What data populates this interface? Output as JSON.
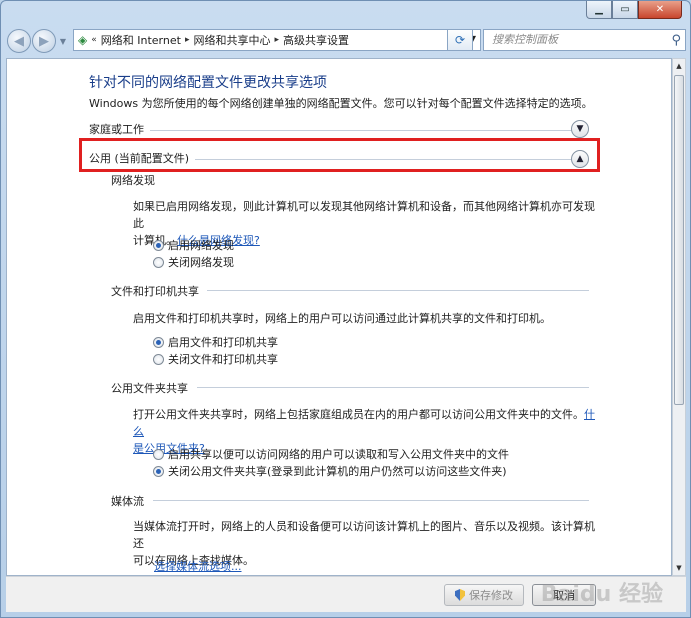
{
  "window": {
    "minimize": "▁",
    "maximize": "▭",
    "close": "✕"
  },
  "nav": {
    "back_icon": "back-arrow-icon",
    "forward_icon": "forward-arrow-icon",
    "breadcrumb": [
      "网络和 Internet",
      "网络和共享中心",
      "高级共享设置"
    ],
    "search_placeholder": "搜索控制面板"
  },
  "page": {
    "heading": "针对不同的网络配置文件更改共享选项",
    "intro": "Windows 为您所使用的每个网络创建单独的网络配置文件。您可以针对每个配置文件选择特定的选项。",
    "profile_home": "家庭或工作",
    "profile_public": "公用 (当前配置文件)"
  },
  "sections": {
    "discovery": {
      "title": "网络发现",
      "desc_line1": "如果已启用网络发现，则此计算机可以发现其他网络计算机和设备，而其他网络计算机亦可发现此",
      "desc_line2": "计算机。",
      "link": "什么是网络发现?",
      "option_on": "启用网络发现",
      "option_off": "关闭网络发现"
    },
    "printer": {
      "title": "文件和打印机共享",
      "desc": "启用文件和打印机共享时，网络上的用户可以访问通过此计算机共享的文件和打印机。",
      "option_on": "启用文件和打印机共享",
      "option_off": "关闭文件和打印机共享"
    },
    "public_folder": {
      "title": "公用文件夹共享",
      "desc_line1": "打开公用文件夹共享时，网络上包括家庭组成员在内的用户都可以访问公用文件夹中的文件。",
      "link1": "什么",
      "link2": "是公用文件夹?",
      "option_on": "启用共享以便可以访问网络的用户可以读取和写入公用文件夹中的文件",
      "option_off": "关闭公用文件夹共享(登录到此计算机的用户仍然可以访问这些文件夹)"
    },
    "media": {
      "title": "媒体流",
      "desc_line1": "当媒体流打开时，网络上的人员和设备便可以访问该计算机上的图片、音乐以及视频。该计算机还",
      "desc_line2": "可以在网络上查找媒体。",
      "link": "选择媒体流选项..."
    }
  },
  "footer": {
    "save": "保存修改",
    "cancel": "取消"
  },
  "watermark": "Baidu 经验"
}
